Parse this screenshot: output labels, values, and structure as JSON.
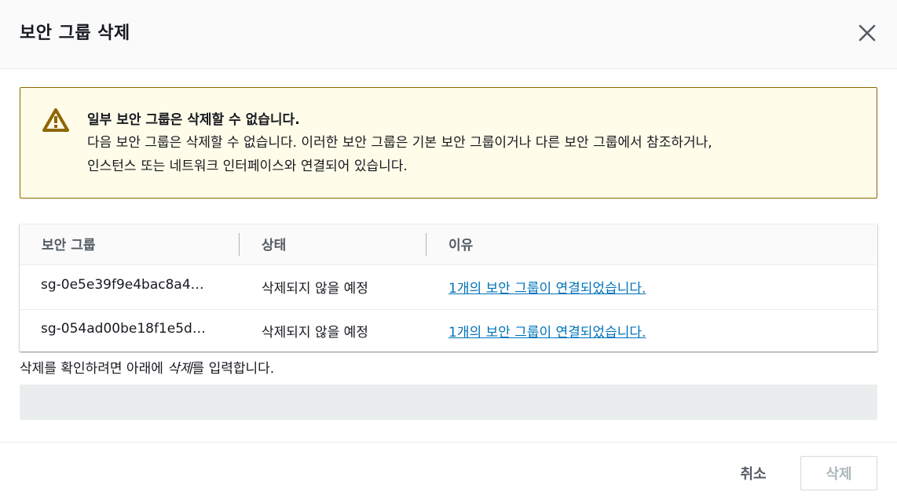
{
  "modal": {
    "title": "보안 그룹 삭제",
    "close_icon": "close-icon"
  },
  "alert": {
    "icon": "warning-icon",
    "icon_color": "#8d6605",
    "title": "일부 보안 그룹은 삭제할 수 없습니다.",
    "body_line1": "다음 보안 그룹은 삭제할 수 없습니다. 이러한 보안 그룹은 기본 보안 그룹이거나 다른 보안 그룹에서 참조하거나,",
    "body_line2": "인스턴스 또는 네트워크 인터페이스와 연결되어 있습니다."
  },
  "table": {
    "headers": {
      "group": "보안 그룹",
      "status": "상태",
      "reason": "이유"
    },
    "rows": [
      {
        "group": "sg-0e5e39f9e4bac8a4…",
        "status": "삭제되지 않을 예정",
        "reason": "1개의 보안 그룹이 연결되었습니다."
      },
      {
        "group": "sg-054ad00be18f1e5d…",
        "status": "삭제되지 않을 예정",
        "reason": "1개의 보안 그룹이 연결되었습니다."
      }
    ]
  },
  "confirm": {
    "prefix": "삭제를 확인하려면 아래에 ",
    "keyword": "삭제",
    "suffix": "를 입력합니다.",
    "input_value": "",
    "input_placeholder": ""
  },
  "footer": {
    "cancel_label": "취소",
    "delete_label": "삭제"
  },
  "colors": {
    "link": "#0073bb",
    "alert_background": "#fffce9",
    "alert_border": "#8d6605",
    "disabled_text": "#aab7b8"
  }
}
